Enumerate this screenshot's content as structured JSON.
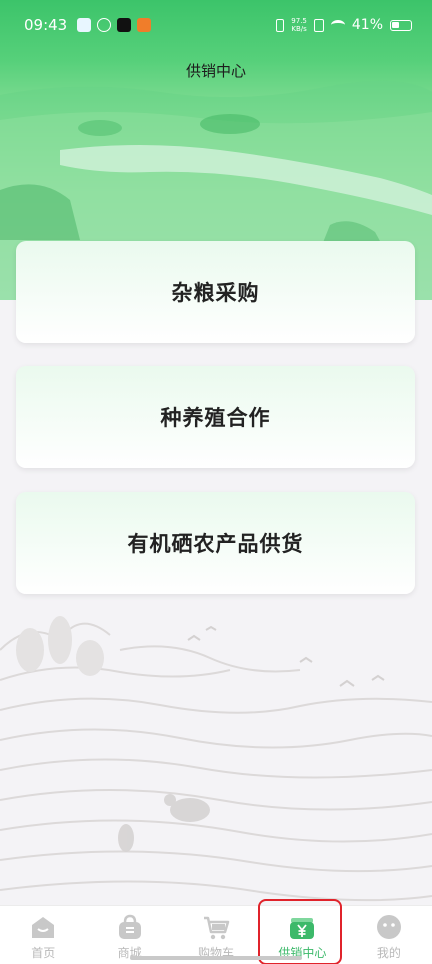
{
  "status_bar": {
    "time": "09:43",
    "net_speed_value": "97.5",
    "net_speed_unit": "KB/s",
    "battery": "41%"
  },
  "header": {
    "title": "供销中心"
  },
  "cards": [
    {
      "label": "杂粮采购"
    },
    {
      "label": "种养殖合作"
    },
    {
      "label": "有机硒农产品供货"
    }
  ],
  "tabbar": {
    "items": [
      {
        "label": "首页",
        "icon": "home-icon"
      },
      {
        "label": "商城",
        "icon": "shopping-bag-icon"
      },
      {
        "label": "购物车",
        "icon": "cart-icon"
      },
      {
        "label": "供销中心",
        "icon": "supply-center-icon",
        "active": true
      },
      {
        "label": "我的",
        "icon": "profile-icon"
      }
    ]
  },
  "colors": {
    "accent": "#3cb96a",
    "highlight": "#e0232b"
  }
}
